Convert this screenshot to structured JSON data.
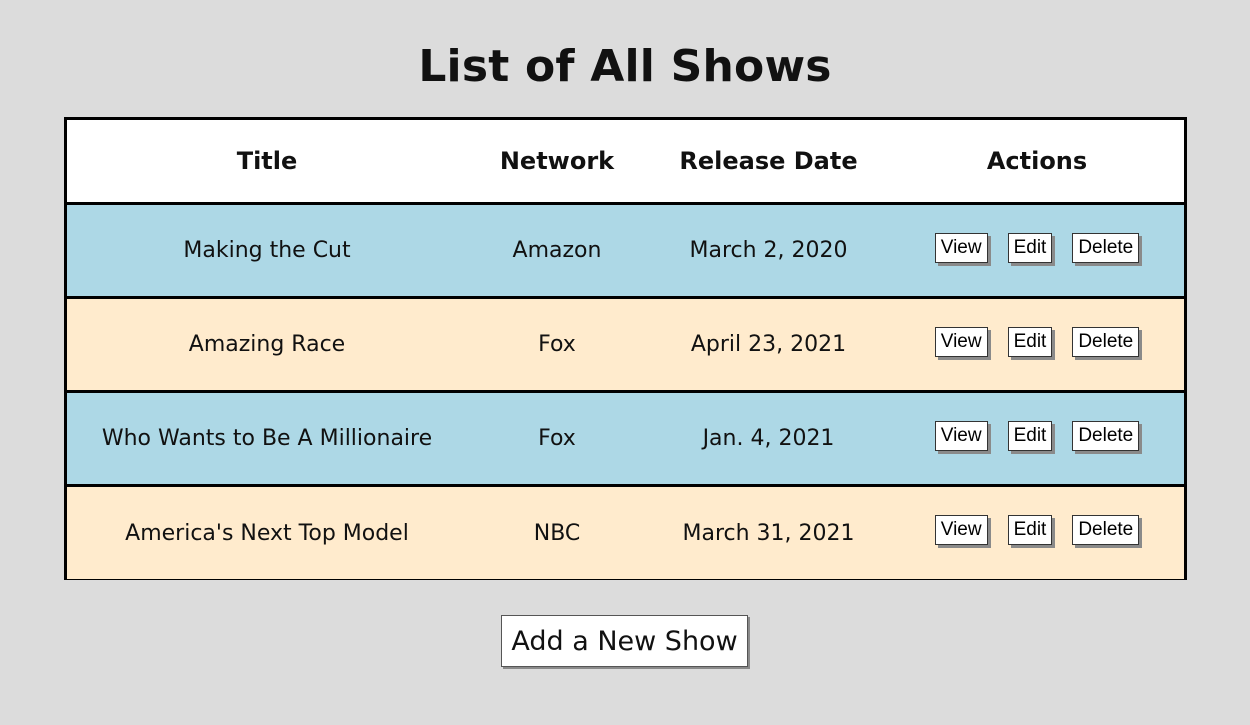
{
  "page": {
    "title": "List of All Shows"
  },
  "table": {
    "headers": {
      "title": "Title",
      "network": "Network",
      "release_date": "Release Date",
      "actions": "Actions"
    },
    "rows": [
      {
        "title": "Making the Cut",
        "network": "Amazon",
        "release_date": "March 2, 2020",
        "view": "View",
        "edit": "Edit",
        "delete": "Delete"
      },
      {
        "title": "Amazing Race",
        "network": "Fox",
        "release_date": "April 23, 2021",
        "view": "View",
        "edit": "Edit",
        "delete": "Delete"
      },
      {
        "title": "Who Wants to Be A Millionaire",
        "network": "Fox",
        "release_date": "Jan. 4, 2021",
        "view": "View",
        "edit": "Edit",
        "delete": "Delete"
      },
      {
        "title": "America's Next Top Model",
        "network": "NBC",
        "release_date": "March 31, 2021",
        "view": "View",
        "edit": "Edit",
        "delete": "Delete"
      }
    ]
  },
  "footer": {
    "add_button_label": "Add a New Show"
  },
  "colors": {
    "background": "#dcdcdc",
    "row_blue": "#add8e6",
    "row_cream": "#ffebcd",
    "header_bg": "#ffffff"
  }
}
